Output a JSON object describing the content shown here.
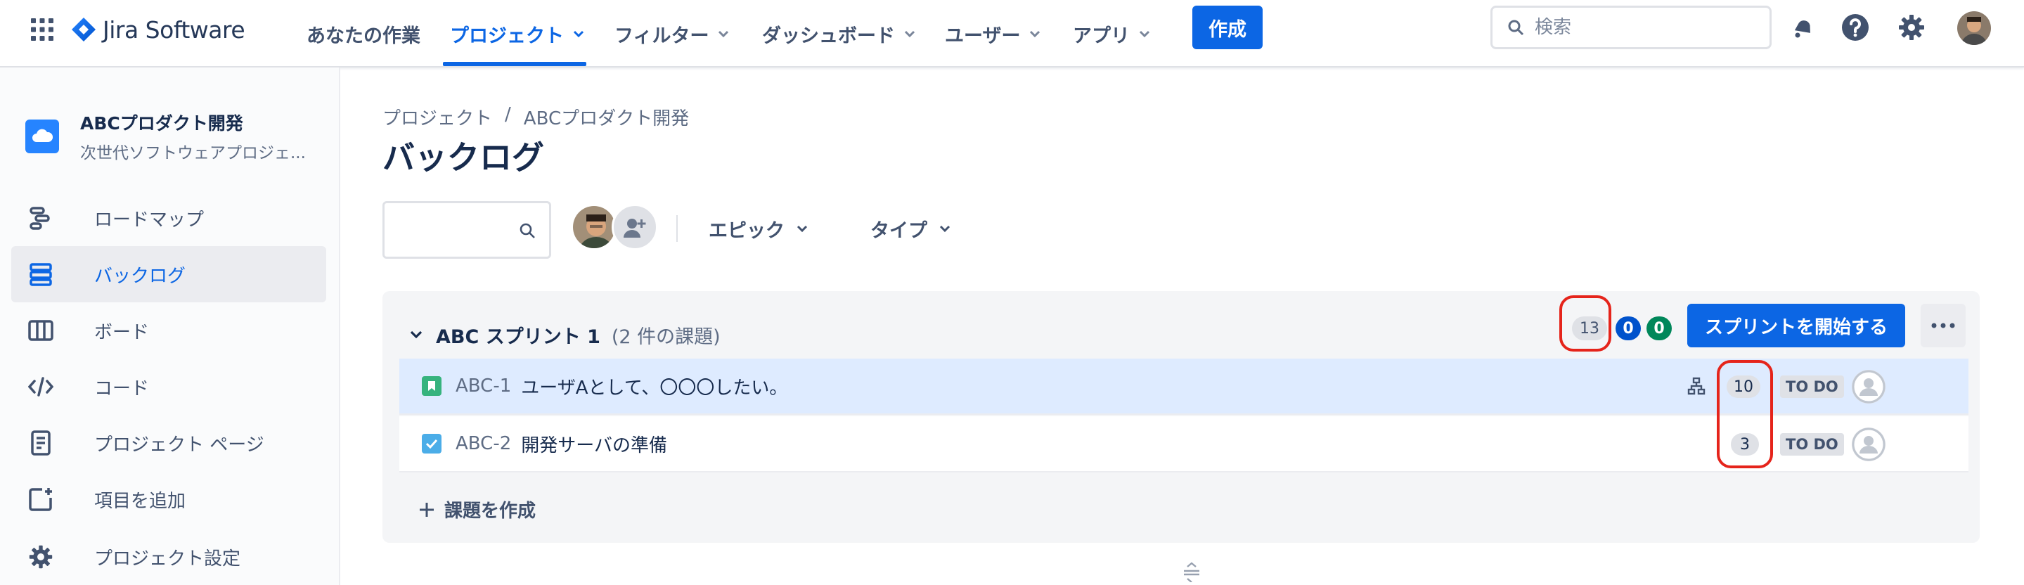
{
  "topnav": {
    "logo_text": "Jira Software",
    "items": [
      {
        "label": "あなたの作業",
        "has_chevron": false
      },
      {
        "label": "プロジェクト",
        "has_chevron": true,
        "active": true
      },
      {
        "label": "フィルター",
        "has_chevron": true
      },
      {
        "label": "ダッシュボード",
        "has_chevron": true
      },
      {
        "label": "ユーザー",
        "has_chevron": true
      },
      {
        "label": "アプリ",
        "has_chevron": true
      }
    ],
    "create_label": "作成",
    "search_placeholder": "検索",
    "icons": [
      "notification-icon",
      "help-icon",
      "settings-icon",
      "user-avatar"
    ],
    "accent_color": "#0c66e4"
  },
  "sidebar": {
    "project_name": "ABCプロダクト開発",
    "project_subtitle": "次世代ソフトウェアプロジェ...",
    "items": [
      {
        "label": "ロードマップ",
        "icon": "roadmap-icon"
      },
      {
        "label": "バックログ",
        "icon": "backlog-icon",
        "active": true
      },
      {
        "label": "ボード",
        "icon": "board-icon"
      },
      {
        "label": "コード",
        "icon": "code-icon"
      },
      {
        "label": "プロジェクト ページ",
        "icon": "page-icon"
      },
      {
        "label": "項目を追加",
        "icon": "add-item-icon"
      },
      {
        "label": "プロジェクト設定",
        "icon": "settings-icon"
      }
    ]
  },
  "main": {
    "breadcrumb": [
      "プロジェクト",
      "ABCプロダクト開発"
    ],
    "breadcrumb_sep": "/",
    "title": "バックログ",
    "filters": {
      "epic_label": "エピック",
      "type_label": "タイプ"
    },
    "sprint": {
      "name": "ABC スプリント 1",
      "issue_count": "(2 件の課題)",
      "points_total": "13",
      "points_in_progress": "0",
      "points_done": "0",
      "start_label": "スプリントを開始する",
      "issues": [
        {
          "key": "ABC-1",
          "summary": "ユーザAとして、〇〇〇したい。",
          "type": "story",
          "estimate": "10",
          "status": "TO DO",
          "has_child": true
        },
        {
          "key": "ABC-2",
          "summary": "開発サーバの準備",
          "type": "task",
          "estimate": "3",
          "status": "TO DO",
          "has_child": false
        }
      ],
      "create_issue_label": "課題を作成"
    }
  },
  "colors": {
    "story": "#36b37e",
    "task": "#4bade8",
    "highlight": "#e5241b",
    "done_pill": "#00875a",
    "progress_pill": "#0052cc"
  }
}
